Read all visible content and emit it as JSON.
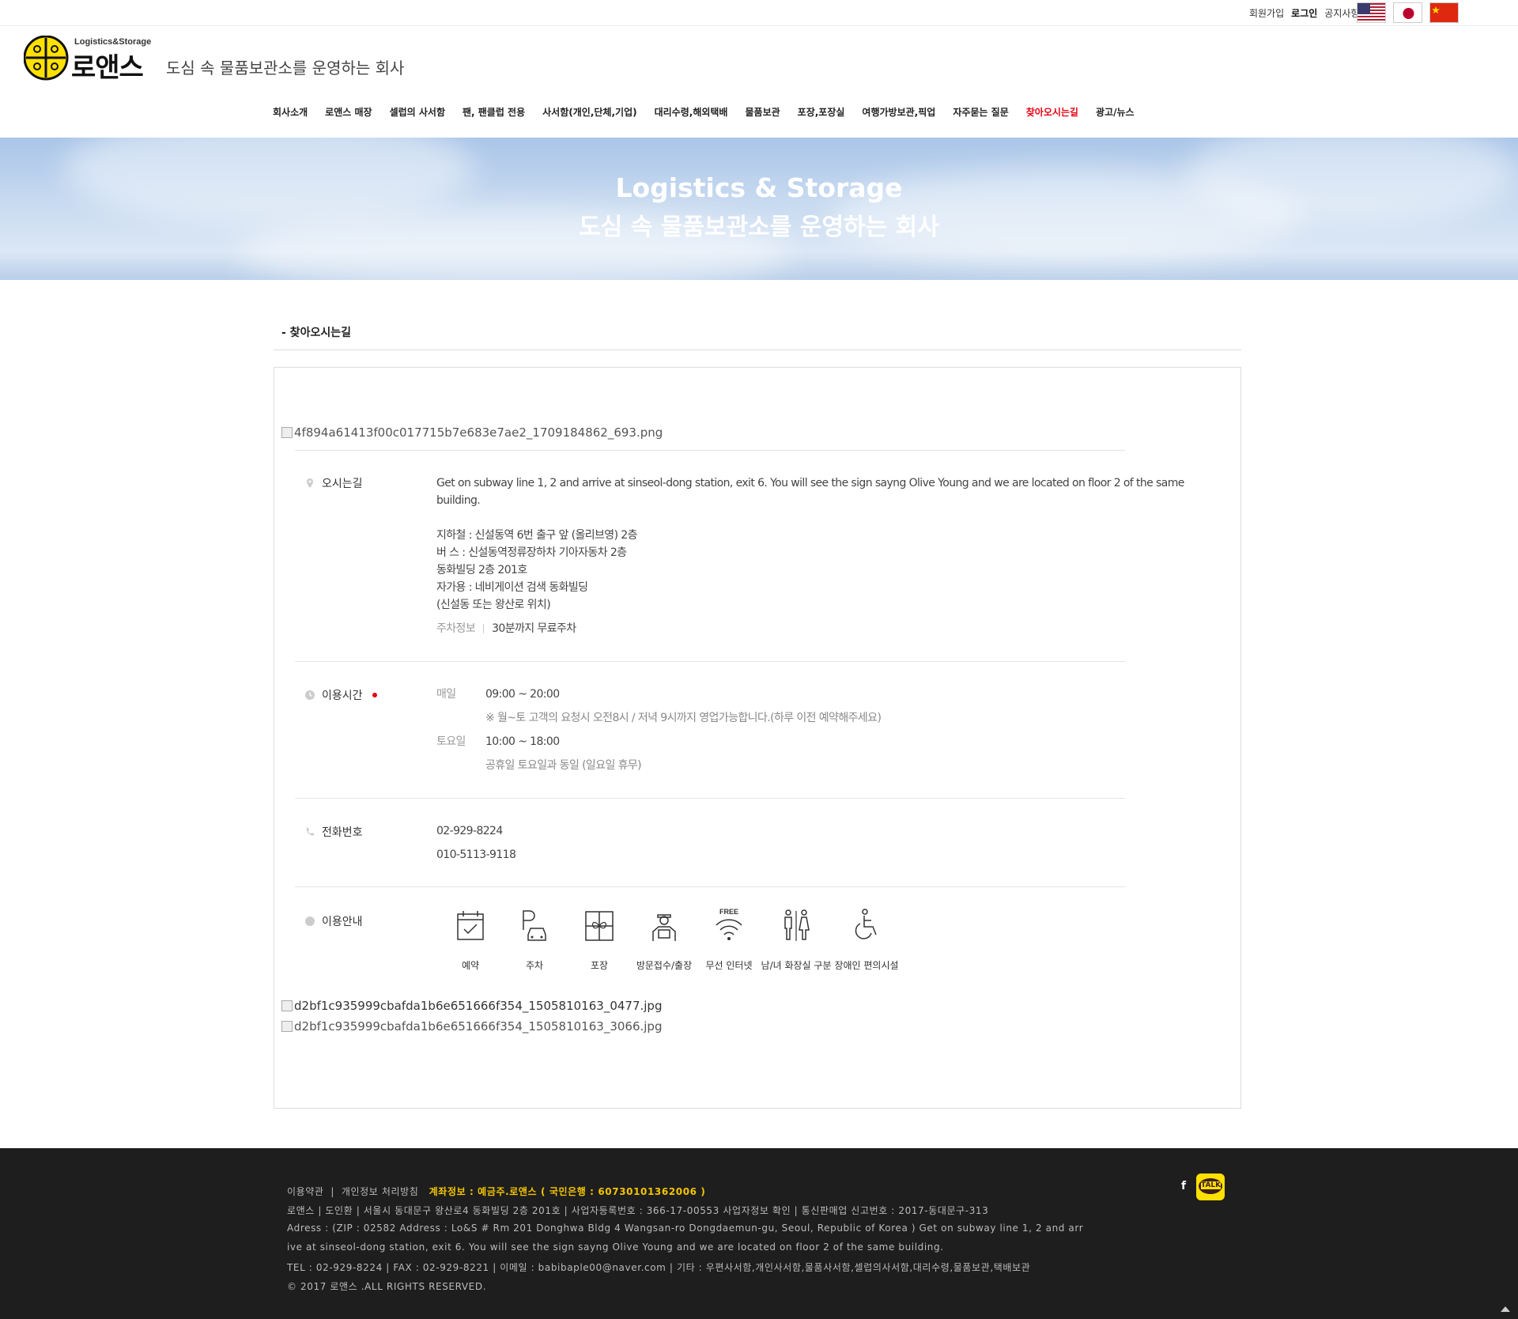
{
  "topbar": {
    "links": [
      "회원가입",
      "로그인",
      "공지사항"
    ],
    "flags": [
      "us-flag-icon",
      "japan-flag-icon",
      "china-flag-icon"
    ]
  },
  "header": {
    "logo_sub": "Logistics&Storage",
    "logo_main": "로앤스",
    "tagline": "도심 속 물품보관소를 운영하는 회사"
  },
  "nav": [
    "회사소개",
    "로앤스 매장",
    "셀럽의 사서함",
    "팬, 팬클럽 전용",
    "사서함(개인,단체,기업)",
    "대리수령,해외택배",
    "물품보관",
    "포장,포장실",
    "여행가방보관,픽업",
    "자주묻는 질문",
    "찾아오시는길",
    "광고/뉴스"
  ],
  "nav_active": "찾아오시는길",
  "banner": {
    "line1": "Logistics & Storage",
    "line2": "도심 속 물품보관소를 운영하는 회사"
  },
  "section_title": "- 찾아오시는길",
  "images": {
    "top": "4f894a61413f00c017715b7e683e7ae2_1709184862_693.png",
    "bottom1": "d2bf1c935999cbafda1b6e651666f354_1505810163_0477.jpg",
    "bottom2": "d2bf1c935999cbafda1b6e651666f354_1505810163_3066.jpg"
  },
  "directions": {
    "label": "오시는길",
    "english": "Get on subway line 1, 2 and arrive at sinseol-dong station, exit 6. You will see the sign sayng Olive Young and we are located on floor 2 of the same",
    "english2": "building.",
    "lines": [
      "지하철 : 신설동역 6번 출구 앞 (올리브영) 2층",
      "버 스 : 신설동역정류장하차 기아자동차 2층",
      "동화빌딩 2층 201호",
      "자가용 : 네비게이션 검색 동화빌딩",
      "(신설동 또는 왕산로 위치)"
    ],
    "parking_key": "주차정보",
    "parking_val": "30분까지 무료주차"
  },
  "hours": {
    "label": "이용시간",
    "daily_key": "매일",
    "daily_val": "09:00 ~ 20:00",
    "daily_note": "※ 월~토 고객의 요청시 오전8시 / 저녁 9시까지 영업가능합니다.(하루 이전 예약해주세요)",
    "sat_key": "토요일",
    "sat_val": "10:00 ~ 18:00",
    "sat_note": "공휴일 토요일과 동일 (일요일 휴무)"
  },
  "phone": {
    "label": "전화번호",
    "numbers": [
      "02-929-8224",
      "010-5113-9118"
    ]
  },
  "amenities": {
    "label": "이용안내",
    "items": [
      {
        "name": "예약",
        "icon": "calendar-check-icon"
      },
      {
        "name": "주차",
        "icon": "parking-car-icon"
      },
      {
        "name": "포장",
        "icon": "gift-box-icon"
      },
      {
        "name": "방문접수/출장",
        "icon": "delivery-person-icon"
      },
      {
        "name": "무선 인터넷",
        "icon": "free-wifi-icon"
      },
      {
        "name": "남/녀 화장실 구분",
        "icon": "restroom-icon"
      },
      {
        "name": "장애인 편의시설",
        "icon": "wheelchair-icon"
      }
    ],
    "wifi_badge": "FREE"
  },
  "footer": {
    "links_terms": "이용약관",
    "links_privacy": "개인정보 처리방침",
    "account": "계좌정보 : 예금주.로앤스 ( 국민은행 : 60730101362006 )",
    "line2": "로앤스  |  도인환  |  서울시 동대문구 왕산로4 동화빌딩 2층 201호  |  사업자등록번호 : 366-17-00553  사업자정보 확인  |  통신판매업 신고번호 : 2017-동대문구-313",
    "line3": "Adress : (ZIP : 02582 Address : Lo&S # Rm 201 Donghwa Bldg 4 Wangsan-ro Dongdaemun-gu, Seoul, Republic of Korea ) Get on subway line 1, 2 and arr",
    "line4": "ive at sinseol-dong station, exit 6. You will see the sign sayng Olive Young and we are located on floor 2 of the same building.",
    "line5": "TEL : 02-929-8224  |  FAX : 02-929-8221  |  이메일 : babibaple00@naver.com  |  기타 : 우편사서함,개인사서함,물품사서함,셀럽의사서함,대리수령,물품보관,택배보관",
    "copyright": "© 2017 로앤스 .ALL RIGHTS RESERVED.",
    "talk": "TALK",
    "facebook": "f"
  }
}
